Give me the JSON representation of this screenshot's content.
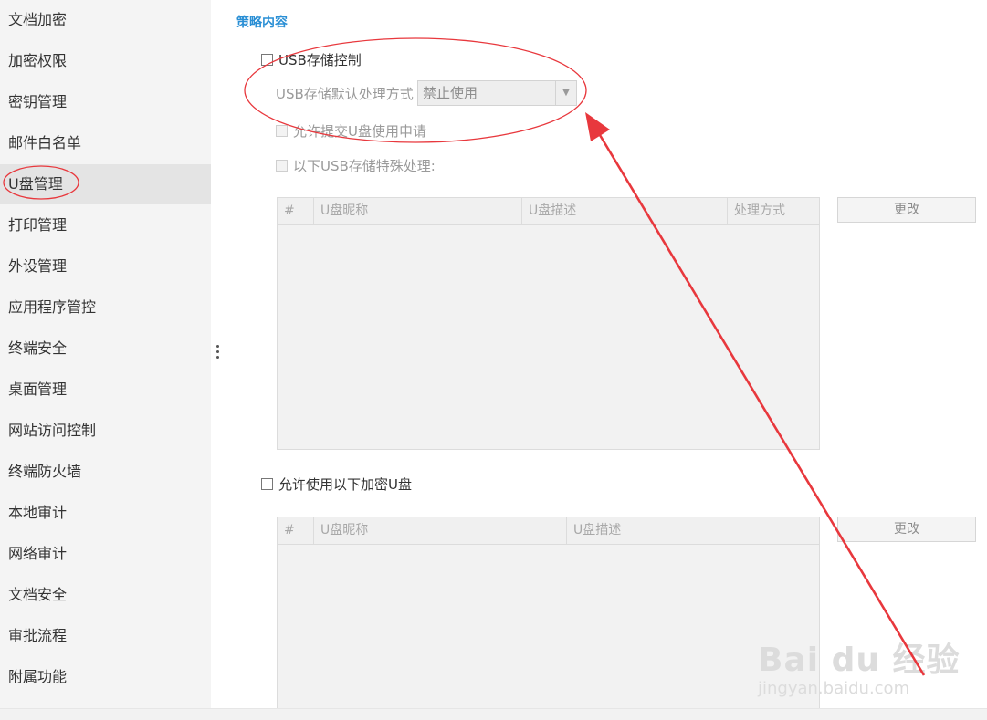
{
  "sidebar": {
    "items": [
      {
        "label": "文档加密"
      },
      {
        "label": "加密权限"
      },
      {
        "label": "密钥管理"
      },
      {
        "label": "邮件白名单"
      },
      {
        "label": "U盘管理",
        "active": true
      },
      {
        "label": "打印管理"
      },
      {
        "label": "外设管理"
      },
      {
        "label": "应用程序管控"
      },
      {
        "label": "终端安全"
      },
      {
        "label": "桌面管理"
      },
      {
        "label": "网站访问控制"
      },
      {
        "label": "终端防火墙"
      },
      {
        "label": "本地审计"
      },
      {
        "label": "网络审计"
      },
      {
        "label": "文档安全"
      },
      {
        "label": "审批流程"
      },
      {
        "label": "附属功能"
      }
    ]
  },
  "content": {
    "section_title": "策略内容",
    "usb_control": {
      "label": "USB存储控制",
      "checked": false
    },
    "default_mode": {
      "label": "USB存储默认处理方式",
      "selected": "禁止使用"
    },
    "allow_request": {
      "label": "允许提交U盘使用申请",
      "checked": false,
      "disabled": true
    },
    "special_handling": {
      "label": "以下USB存储特殊处理:",
      "checked": false,
      "disabled": true
    },
    "special_table": {
      "columns": [
        "#",
        "U盘昵称",
        "U盘描述",
        "处理方式"
      ],
      "rows": []
    },
    "special_change_button": "更改",
    "allow_encrypted": {
      "label": "允许使用以下加密U盘",
      "checked": false
    },
    "encrypted_table": {
      "columns": [
        "#",
        "U盘昵称",
        "U盘描述"
      ],
      "rows": []
    },
    "encrypted_change_button": "更改"
  },
  "watermark": {
    "brand": "Bai du 经验",
    "url": "jingyan.baidu.com"
  },
  "colors": {
    "accent": "#2a8fd5",
    "annotation": "#e8383d",
    "sidebar_bg": "#f4f4f4",
    "sidebar_active": "#e4e4e4"
  },
  "icons": {
    "splitter": "vertical-ellipsis-icon",
    "dropdown": "chevron-down-icon",
    "watermark_logo": "baidu-paw-icon"
  }
}
